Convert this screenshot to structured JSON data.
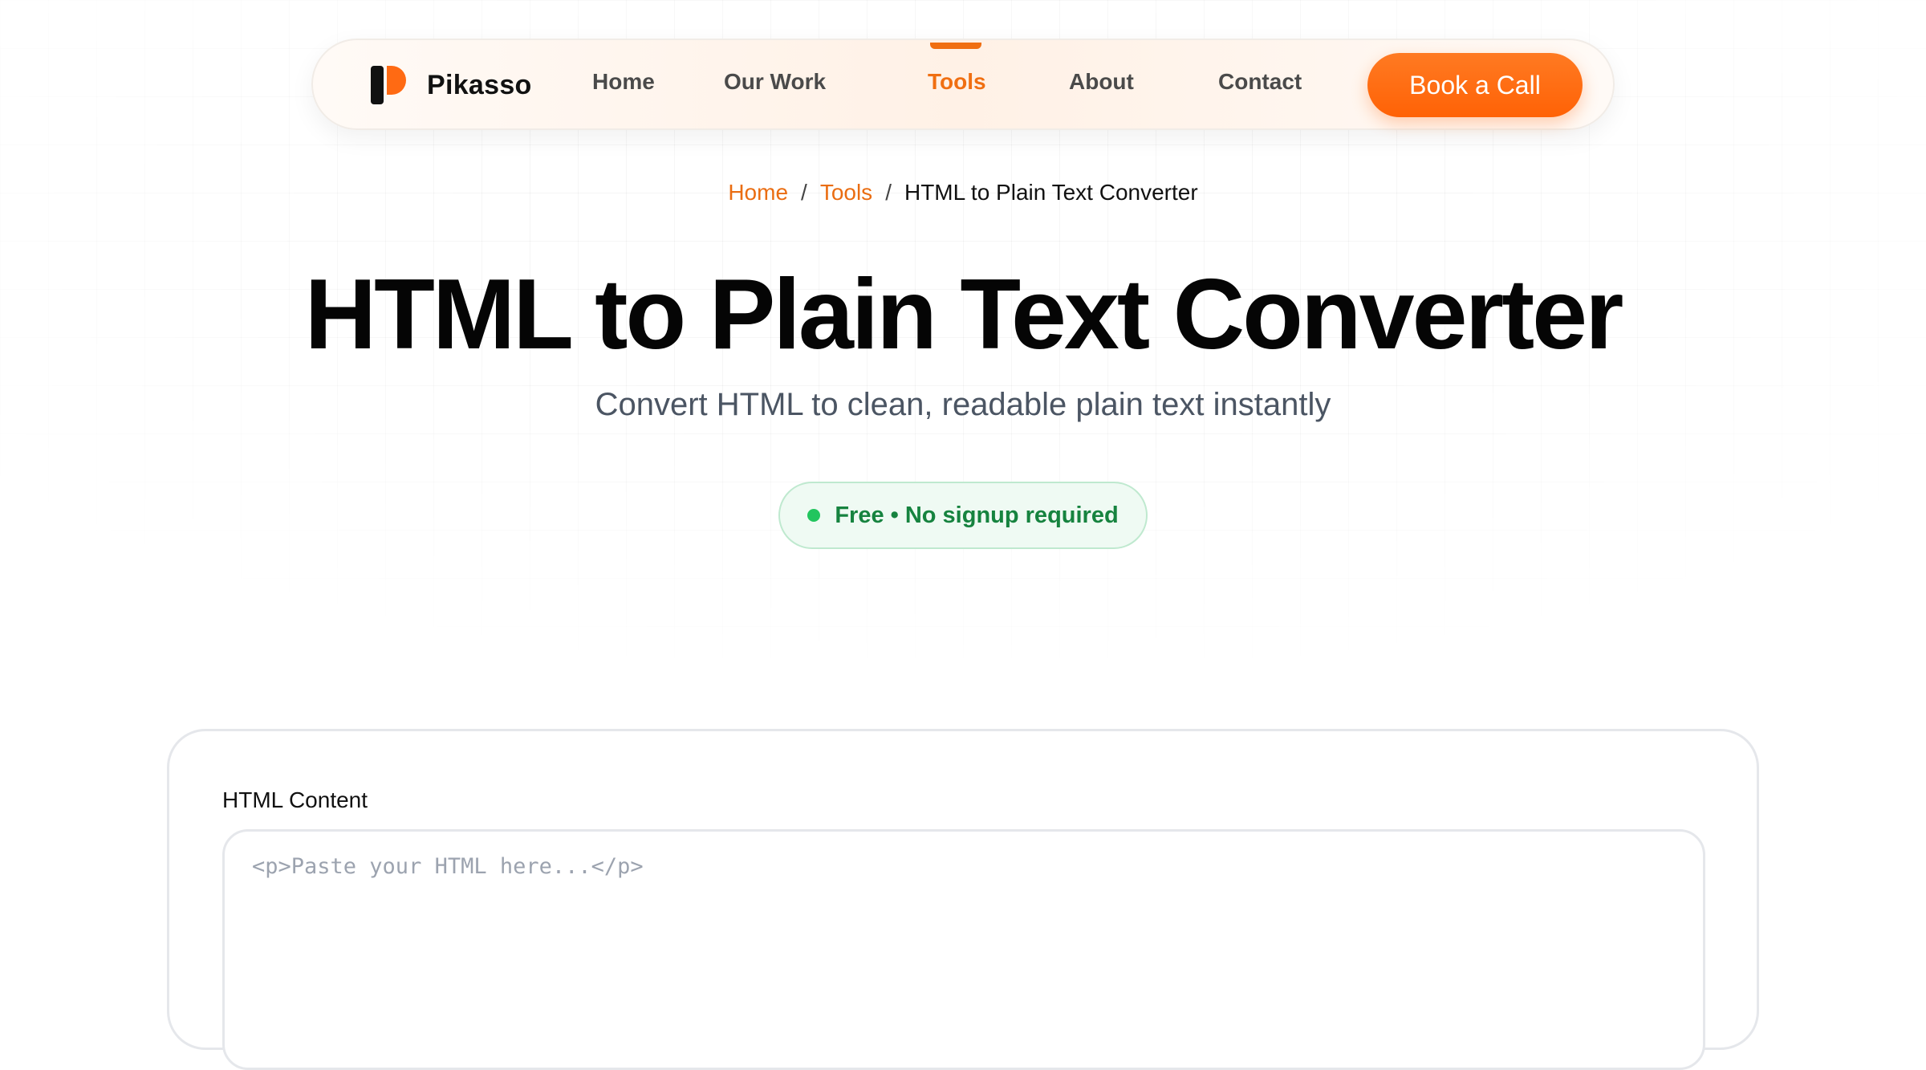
{
  "nav": {
    "brand": "Pikasso",
    "links": [
      {
        "label": "Home",
        "active": false
      },
      {
        "label": "Our Work",
        "active": false
      },
      {
        "label": "Tools",
        "active": true
      },
      {
        "label": "About",
        "active": false
      },
      {
        "label": "Contact",
        "active": false
      }
    ],
    "cta_label": "Book a Call",
    "accent_color": "#ff6a13"
  },
  "breadcrumb": {
    "items": [
      "Home",
      "Tools"
    ],
    "current": "HTML to Plain Text Converter",
    "separator": "/"
  },
  "hero": {
    "title": "HTML to Plain Text Converter",
    "subtitle": "Convert HTML to clean, readable plain text instantly",
    "badge": "Free • No signup required",
    "badge_color": "#22c55e"
  },
  "tool": {
    "input_label": "HTML Content",
    "input_placeholder": "<p>Paste your HTML here...</p>",
    "input_value": ""
  }
}
